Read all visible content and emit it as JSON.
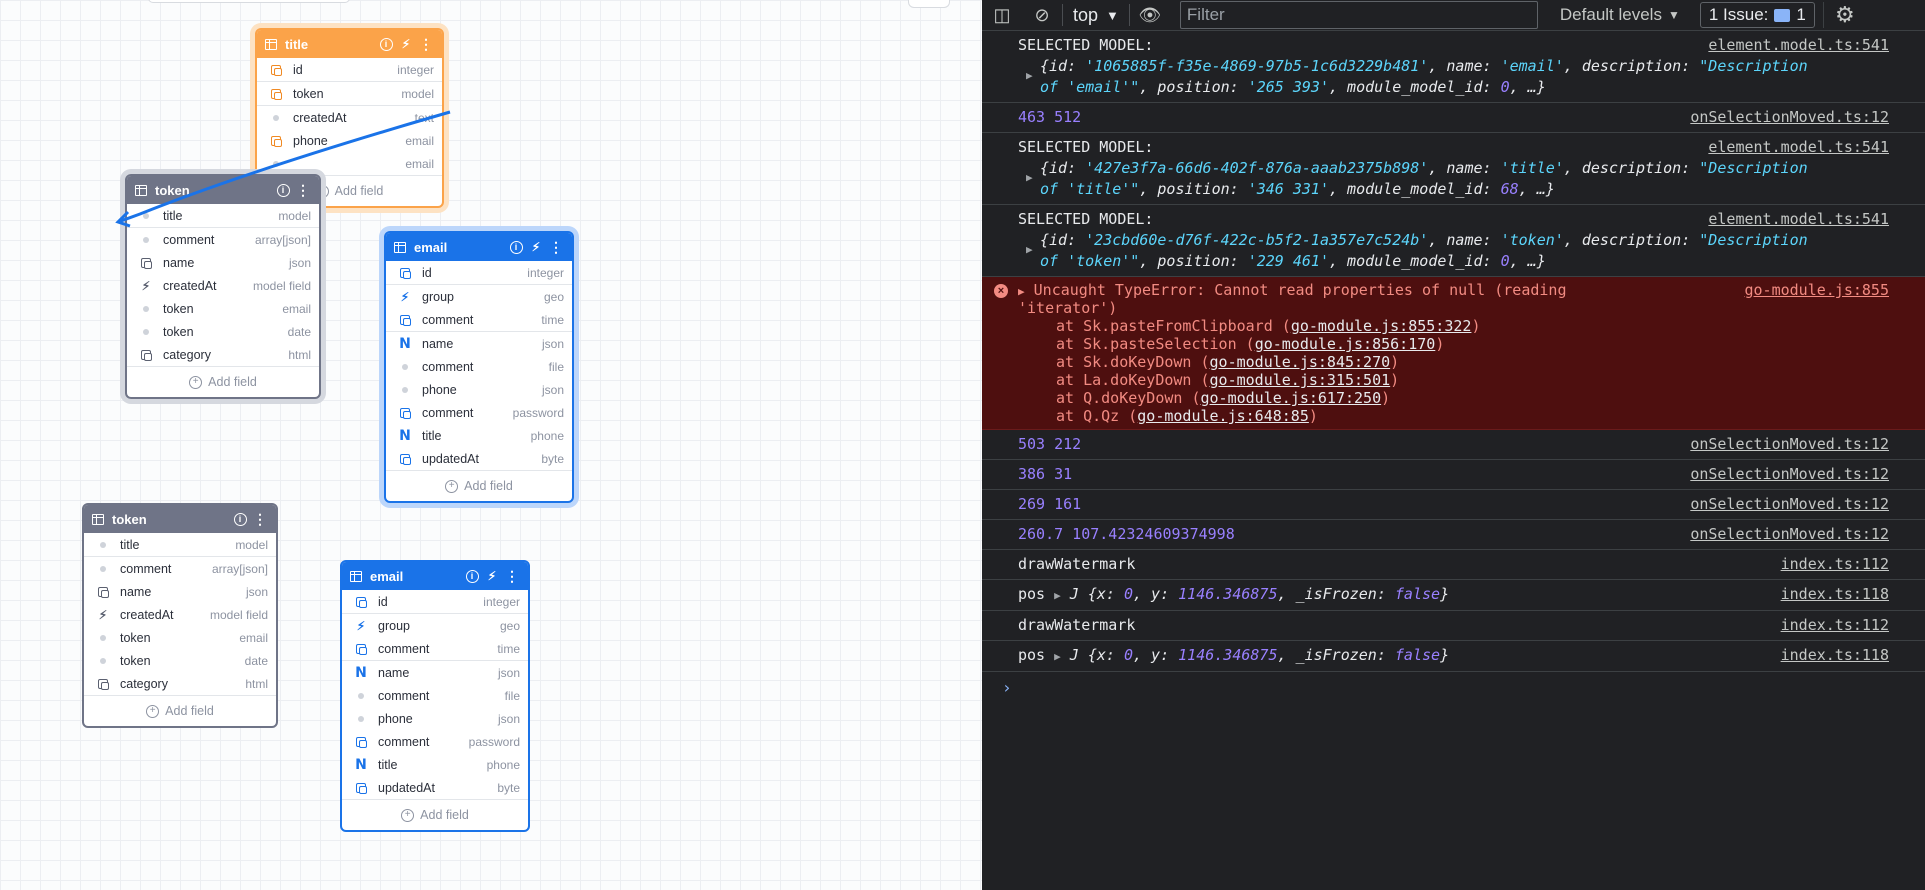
{
  "cards": {
    "orange_title": {
      "title": "title",
      "fields": [
        {
          "name": "id",
          "type": "integer",
          "icon": "key"
        },
        {
          "name": "token",
          "type": "model",
          "icon": "key"
        },
        {
          "name": "createdAt",
          "type": "text",
          "icon": "dot"
        },
        {
          "name": "phone",
          "type": "email",
          "icon": "key"
        },
        {
          "name": "",
          "type": "email",
          "icon": "dot"
        }
      ],
      "add_label": "Add field"
    },
    "gray_token_sel": {
      "title": "token",
      "fields": [
        {
          "name": "title",
          "type": "model",
          "icon": "dot"
        },
        {
          "name": "comment",
          "type": "array[json]",
          "icon": "dot"
        },
        {
          "name": "name",
          "type": "json",
          "icon": "key"
        },
        {
          "name": "createdAt",
          "type": "model field",
          "icon": "bolt"
        },
        {
          "name": "token",
          "type": "email",
          "icon": "dot"
        },
        {
          "name": "token",
          "type": "date",
          "icon": "dot"
        },
        {
          "name": "category",
          "type": "html",
          "icon": "key"
        }
      ],
      "add_label": "Add field"
    },
    "blue_email_sel": {
      "title": "email",
      "fields": [
        {
          "name": "id",
          "type": "integer",
          "icon": "key"
        },
        {
          "name": "group",
          "type": "geo",
          "icon": "bolt"
        },
        {
          "name": "comment",
          "type": "time",
          "icon": "key"
        },
        {
          "name": "name",
          "type": "json",
          "icon": "nn"
        },
        {
          "name": "comment",
          "type": "file",
          "icon": "dot"
        },
        {
          "name": "phone",
          "type": "json",
          "icon": "dot"
        },
        {
          "name": "comment",
          "type": "password",
          "icon": "key"
        },
        {
          "name": "title",
          "type": "phone",
          "icon": "nn"
        },
        {
          "name": "updatedAt",
          "type": "byte",
          "icon": "key"
        }
      ],
      "add_label": "Add field"
    },
    "gray_token": {
      "title": "token",
      "fields": [
        {
          "name": "title",
          "type": "model",
          "icon": "dot"
        },
        {
          "name": "comment",
          "type": "array[json]",
          "icon": "dot"
        },
        {
          "name": "name",
          "type": "json",
          "icon": "key"
        },
        {
          "name": "createdAt",
          "type": "model field",
          "icon": "bolt"
        },
        {
          "name": "token",
          "type": "email",
          "icon": "dot"
        },
        {
          "name": "token",
          "type": "date",
          "icon": "dot"
        },
        {
          "name": "category",
          "type": "html",
          "icon": "key"
        }
      ],
      "add_label": "Add field"
    },
    "blue_email": {
      "title": "email",
      "fields": [
        {
          "name": "id",
          "type": "integer",
          "icon": "key"
        },
        {
          "name": "group",
          "type": "geo",
          "icon": "bolt"
        },
        {
          "name": "comment",
          "type": "time",
          "icon": "key"
        },
        {
          "name": "name",
          "type": "json",
          "icon": "nn"
        },
        {
          "name": "comment",
          "type": "file",
          "icon": "dot"
        },
        {
          "name": "phone",
          "type": "json",
          "icon": "dot"
        },
        {
          "name": "comment",
          "type": "password",
          "icon": "key"
        },
        {
          "name": "title",
          "type": "phone",
          "icon": "nn"
        },
        {
          "name": "updatedAt",
          "type": "byte",
          "icon": "key"
        }
      ],
      "add_label": "Add field"
    }
  },
  "devtools": {
    "toolbar": {
      "context": "top",
      "filter_placeholder": "Filter",
      "levels": "Default levels",
      "issues": "1 Issue:",
      "issue_count": "1"
    },
    "console": {
      "sel1": {
        "label": "SELECTED MODEL:",
        "src": "element.model.ts:541",
        "id": "'1065885f-f35e-4869-97b5-1c6d3229b481'",
        "name": "'email'",
        "desc1": "\"Description",
        "desc2": "of 'email'\"",
        "position": "'265 393'",
        "mmid": "0"
      },
      "num1": {
        "text": "463 512",
        "src": "onSelectionMoved.ts:12"
      },
      "sel2": {
        "label": "SELECTED MODEL:",
        "src": "element.model.ts:541",
        "id": "'427e3f7a-66d6-402f-876a-aaab2375b898'",
        "name": "'title'",
        "desc1": "\"Description",
        "desc2": "of 'title'\"",
        "position": "'346 331'",
        "mmid": "68"
      },
      "sel3": {
        "label": "SELECTED MODEL:",
        "src": "element.model.ts:541",
        "id": "'23cbd60e-d76f-422c-b5f2-1a357e7c524b'",
        "name": "'token'",
        "desc1": "\"Description",
        "desc2": "of 'token'\"",
        "position": "'229 461'",
        "mmid": "0"
      },
      "error": {
        "msg1": "Uncaught TypeError: Cannot read properties of null (reading",
        "msg2": "'iterator')",
        "src": "go-module.js:855",
        "stack": [
          {
            "fn": "at Sk.pasteFromClipboard (",
            "loc": "go-module.js:855:322"
          },
          {
            "fn": "at Sk.pasteSelection (",
            "loc": "go-module.js:856:170"
          },
          {
            "fn": "at Sk.doKeyDown (",
            "loc": "go-module.js:845:270"
          },
          {
            "fn": "at La.doKeyDown (",
            "loc": "go-module.js:315:501"
          },
          {
            "fn": "at Q.doKeyDown (",
            "loc": "go-module.js:617:250"
          },
          {
            "fn": "at Q.Qz (",
            "loc": "go-module.js:648:85"
          }
        ]
      },
      "nums": [
        {
          "text": "503 212",
          "src": "onSelectionMoved.ts:12"
        },
        {
          "text": "386 31",
          "src": "onSelectionMoved.ts:12"
        },
        {
          "text": "269 161",
          "src": "onSelectionMoved.ts:12"
        },
        {
          "text": "260.7 107.42324609374998",
          "src": "onSelectionMoved.ts:12"
        }
      ],
      "draw1": {
        "text": "drawWatermark",
        "src": "index.ts:112"
      },
      "pos1": {
        "label": "pos",
        "src": "index.ts:118",
        "obj": "J",
        "x": "0",
        "y": "1146.346875",
        "frozen": "false"
      },
      "draw2": {
        "text": "drawWatermark",
        "src": "index.ts:112"
      },
      "pos2": {
        "label": "pos",
        "src": "index.ts:118",
        "obj": "J",
        "x": "0",
        "y": "1146.346875",
        "frozen": "false"
      }
    }
  }
}
